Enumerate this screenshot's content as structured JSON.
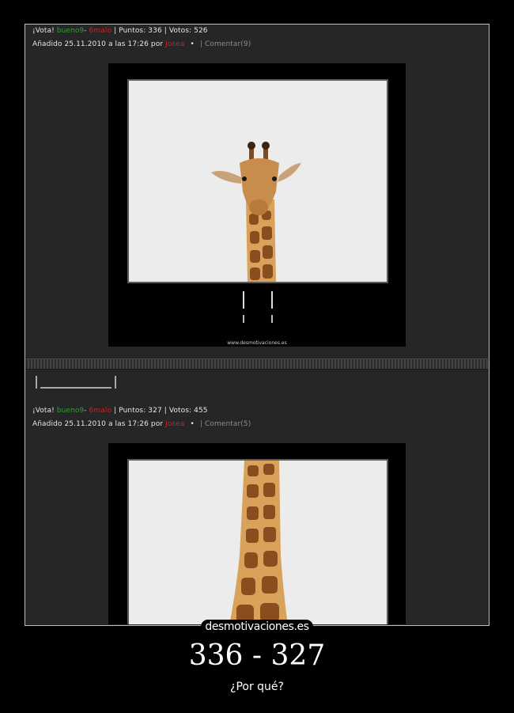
{
  "post1": {
    "vote_label": "¡Vota!",
    "good_label": "bueno",
    "good_count": "9",
    "dash": "-",
    "bad_count": "6",
    "bad_label": "malo",
    "points": "| Puntos: 336 | Votos: 526",
    "added": "Añadido 25.11.2010 a las 17:26 por",
    "author": "Josea",
    "bullet": "•",
    "comments": "| Comentar(9)",
    "poster_watermark": "www.desmotivaciones.es"
  },
  "post2": {
    "vote_label": "¡Vota!",
    "good_label": "bueno",
    "good_count": "9",
    "dash": "-",
    "bad_count": "6",
    "bad_label": "malo",
    "points": "| Puntos: 327 | Votos: 455",
    "added": "Añadido 25.11.2010 a las 17:26 por",
    "author": "Josea",
    "bullet": "•",
    "comments": "| Comentar(5)"
  },
  "brand": "desmotivaciones.es",
  "caption_title": "336 - 327",
  "caption_subtitle": "¿Por qué?",
  "colors": {
    "good": "#2f9e35",
    "bad": "#c42424",
    "background": "#000000"
  }
}
